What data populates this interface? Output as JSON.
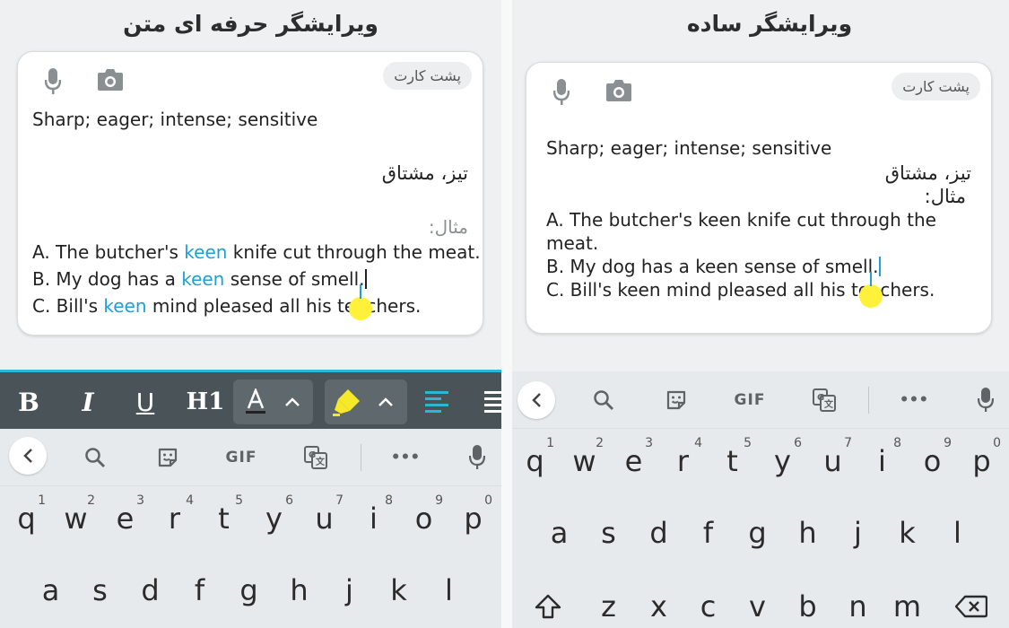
{
  "left": {
    "title": "ویرایشگر حرفه ای متن",
    "card_back_label": "پشت کارت",
    "definition": "Sharp; eager; intense; sensitive",
    "translation": "تیز، مشتاق",
    "example_label": "مثال:",
    "examples": [
      {
        "pre": "A. The butcher's ",
        "kw": "keen",
        "post": " knife cut through the meat."
      },
      {
        "pre": "B. My dog has a ",
        "kw": "keen",
        "post": " sense of smell."
      },
      {
        "pre": "C. Bill's ",
        "kw": "keen",
        "post": " mind pleased all his teachers."
      }
    ],
    "format_buttons": {
      "bold": "B",
      "italic": "I",
      "underline": "U",
      "heading": "H1"
    }
  },
  "right": {
    "title": "ویرایشگر  ساده",
    "card_back_label": "پشت کارت",
    "definition": "Sharp; eager; intense; sensitive",
    "translation": "تیز، مشتاق",
    "example_label": "مثال:",
    "lines": [
      "A. The butcher's keen knife cut through the",
      "meat.",
      "B. My dog has a keen sense of smell.",
      "C. Bill's keen mind pleased all his teachers."
    ]
  },
  "keyboard": {
    "gif_label": "GIF",
    "more_label": "•••",
    "row1": [
      {
        "k": "q",
        "n": "1"
      },
      {
        "k": "w",
        "n": "2"
      },
      {
        "k": "e",
        "n": "3"
      },
      {
        "k": "r",
        "n": "4"
      },
      {
        "k": "t",
        "n": "5"
      },
      {
        "k": "y",
        "n": "6"
      },
      {
        "k": "u",
        "n": "7"
      },
      {
        "k": "i",
        "n": "8"
      },
      {
        "k": "o",
        "n": "9"
      },
      {
        "k": "p",
        "n": "0"
      }
    ],
    "row2": [
      "a",
      "s",
      "d",
      "f",
      "g",
      "h",
      "j",
      "k",
      "l"
    ],
    "row3": [
      "z",
      "x",
      "c",
      "v",
      "b",
      "n",
      "m"
    ]
  },
  "colors": {
    "accent": "#1ea0d6",
    "highlighter": "#f5e92a",
    "toolbar": "#4a5458"
  },
  "icons": [
    "mic-icon",
    "camera-icon",
    "search-icon",
    "sticker-icon",
    "translate-icon",
    "chevron-left-icon",
    "shift-icon",
    "backspace-icon",
    "highlighter-icon",
    "text-color-icon",
    "align-left-icon"
  ]
}
